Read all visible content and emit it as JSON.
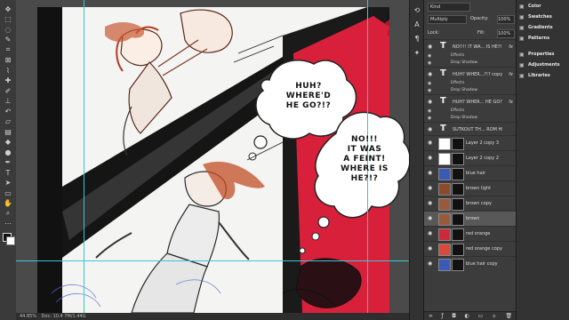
{
  "toolbar": {
    "tools": [
      "move-icon",
      "marquee-icon",
      "lasso-icon",
      "quick-select-icon",
      "crop-icon",
      "frame-icon",
      "eyedropper-icon",
      "healing-icon",
      "brush-icon",
      "clone-stamp-icon",
      "history-brush-icon",
      "eraser-icon",
      "gradient-icon",
      "blur-icon",
      "dodge-icon",
      "pen-icon",
      "type-icon",
      "path-select-icon",
      "rectangle-icon",
      "hand-icon",
      "zoom-icon",
      "more-tools-icon"
    ]
  },
  "canvas": {
    "bubble1": "HUH?\nWHERE'D\nHE GO?!?",
    "bubble2": "NO!!!\nIT WAS\nA FEINT!\nWHERE IS\nHE?!?"
  },
  "status": {
    "zoom": "44.85%",
    "doc": "Doc: 10.4 7M/1.44G"
  },
  "layers_panel": {
    "filter": "Kind",
    "blend_mode": "Multiply",
    "opacity_label": "Opacity:",
    "opacity_value": "100%",
    "lock_label": "Lock:",
    "fill_label": "Fill:",
    "fill_value": "100%",
    "layers": [
      {
        "kind": "text",
        "name": "NO!!!! IT WA... IS HE?!?!",
        "fx": "fx"
      },
      {
        "kind": "effect",
        "name": "Effects"
      },
      {
        "kind": "effect",
        "name": "Drop Shadow"
      },
      {
        "kind": "text",
        "name": "HUH? WHER...?!? copy",
        "fx": "fx"
      },
      {
        "kind": "effect",
        "name": "Effects"
      },
      {
        "kind": "effect",
        "name": "Drop Shadow"
      },
      {
        "kind": "text",
        "name": "HUH? WHER... HE GO?!?",
        "fx": "fx"
      },
      {
        "kind": "effect",
        "name": "Effects"
      },
      {
        "kind": "effect",
        "name": "Drop Shadow"
      },
      {
        "kind": "text",
        "name": "SUTKOUT TH... ROM HIM...",
        "fx": ""
      },
      {
        "kind": "pixel",
        "name": "Layer 2 copy 3"
      },
      {
        "kind": "pixel",
        "name": "Layer 2 copy 2"
      },
      {
        "kind": "pixel",
        "name": "blue hair"
      },
      {
        "kind": "pixel",
        "name": "brown light"
      },
      {
        "kind": "pixel",
        "name": "brown copy"
      },
      {
        "kind": "pixel",
        "name": "brown",
        "selected": true
      },
      {
        "kind": "pixel",
        "name": "red orange"
      },
      {
        "kind": "pixel",
        "name": "red orange copy"
      },
      {
        "kind": "pixel",
        "name": "blue hair copy"
      }
    ]
  },
  "right_panel": {
    "items": [
      "Color",
      "Swatches",
      "Gradients",
      "Patterns",
      "Properties",
      "Adjustments",
      "Libraries"
    ]
  }
}
